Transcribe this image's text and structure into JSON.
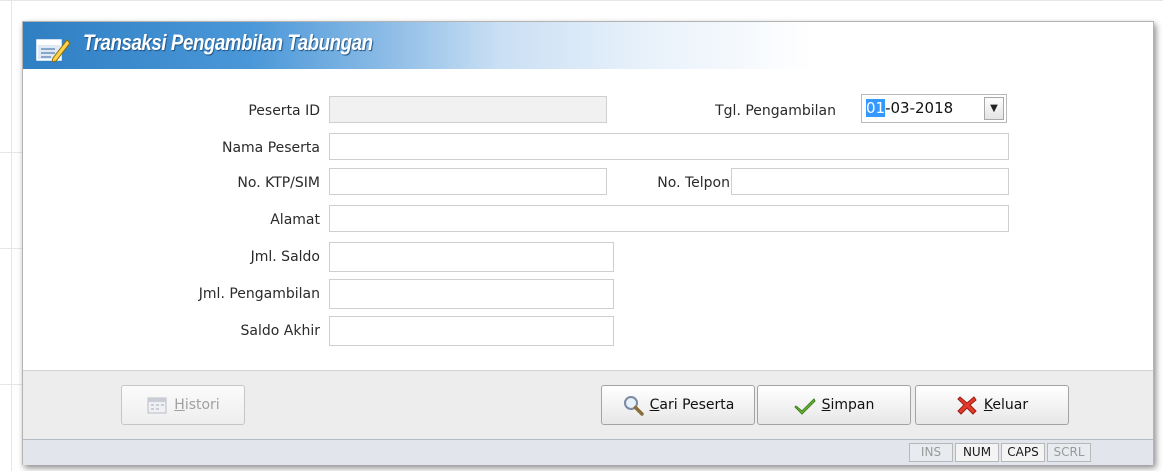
{
  "window": {
    "title": "Transaksi Pengambilan Tabungan",
    "title_icon": "document-pen-icon"
  },
  "form": {
    "peserta_id": {
      "label": "Peserta ID",
      "value": ""
    },
    "tgl_pengambilan": {
      "label": "Tgl. Pengambilan",
      "day": "01",
      "rest": "-03-2018"
    },
    "nama_peserta": {
      "label": "Nama Peserta",
      "value": ""
    },
    "no_ktp": {
      "label": "No. KTP/SIM",
      "value": ""
    },
    "no_telpon": {
      "label": "No. Telpon",
      "value": ""
    },
    "alamat": {
      "label": "Alamat",
      "value": ""
    },
    "jml_saldo": {
      "label": "Jml. Saldo",
      "value": ""
    },
    "jml_pengambilan": {
      "label": "Jml. Pengambilan",
      "value": ""
    },
    "saldo_akhir": {
      "label": "Saldo Akhir",
      "value": ""
    }
  },
  "buttons": {
    "histori": {
      "hot": "H",
      "rest": "istori",
      "icon": "calendar-icon",
      "enabled": false
    },
    "cari": {
      "hot": "C",
      "rest": "ari Peserta",
      "icon": "magnifier-icon"
    },
    "simpan": {
      "hot": "S",
      "rest": "impan",
      "icon": "checkmark-icon"
    },
    "keluar": {
      "hot": "K",
      "rest": "eluar",
      "icon": "red-x-icon"
    }
  },
  "status": {
    "ins": {
      "label": "INS",
      "active": false
    },
    "num": {
      "label": "NUM",
      "active": true
    },
    "caps": {
      "label": "CAPS",
      "active": true
    },
    "scrl": {
      "label": "SCRL",
      "active": false
    }
  },
  "colors": {
    "titlebar": "#2f7fc3",
    "button_bar": "#ededed",
    "status_bar": "#e2e6ec",
    "date_highlight": "#3399ff"
  }
}
